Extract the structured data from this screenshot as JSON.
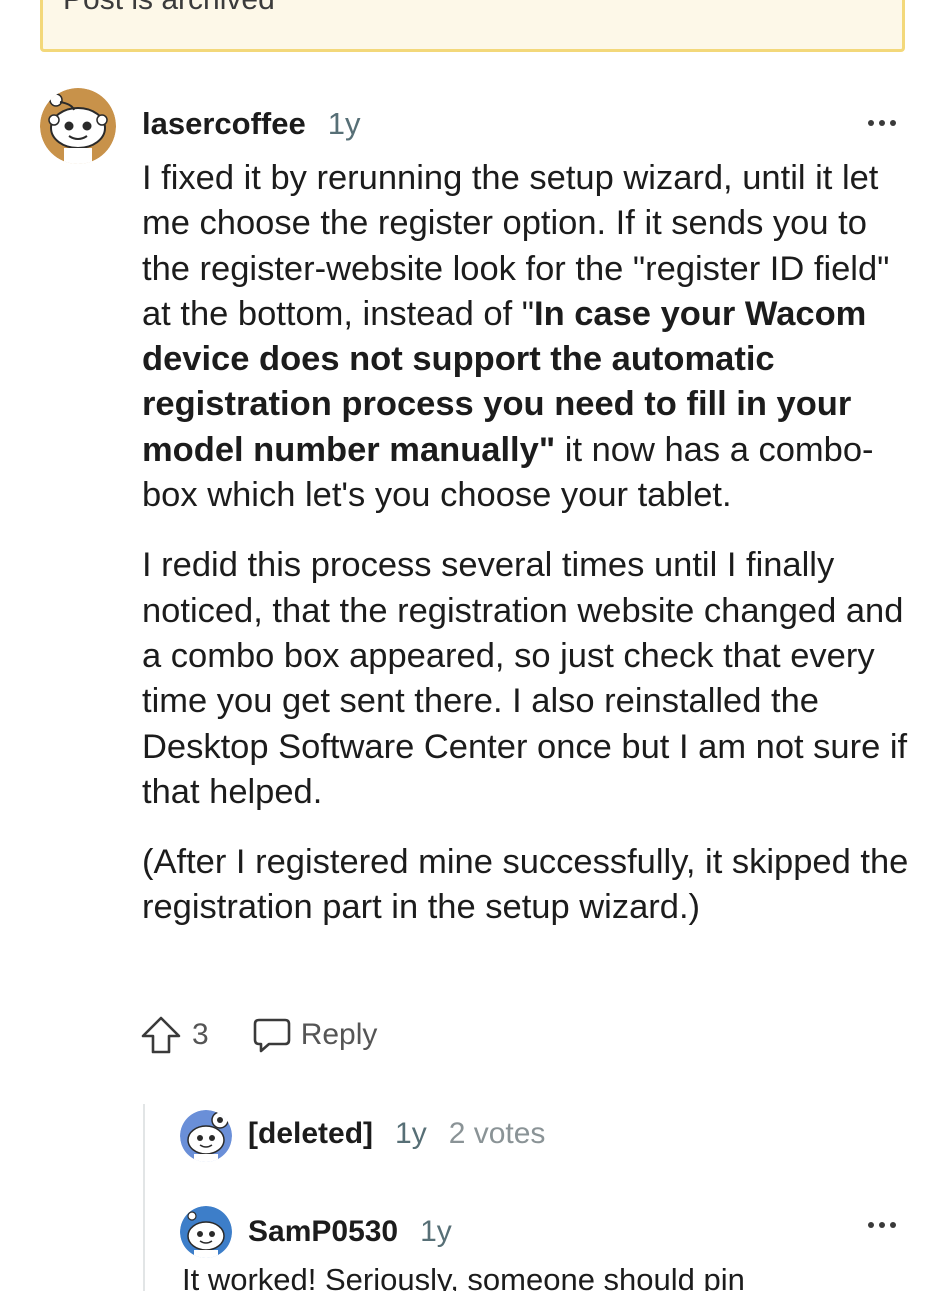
{
  "banner": {
    "text": "Post is archived"
  },
  "comments": [
    {
      "username": "lasercoffee",
      "age": "1y",
      "paragraphs": {
        "p1_a": "I fixed it by rerunning the setup wizard, until it let me choose the register option. If it sends you to the register-website look for the \"register ID field\" at the bottom, instead of \"",
        "p1_bold": "In case your Wacom device does not support the automatic registration process you need to fill in your model number manually\"",
        "p1_b": " it now has a combo-box which let's you choose your tablet.",
        "p2": "I redid this process several times until I finally noticed, that the registration website changed and a combo box appeared, so just check that every time you get sent there. I also reinstalled the Desktop Software Center once but I am not sure if that helped.",
        "p3": "(After I registered mine successfully, it skipped the registration part in the setup wizard.)"
      },
      "votes": "3",
      "reply_label": "Reply",
      "more_icon": "more-horizontal-icon"
    }
  ],
  "replies": [
    {
      "username": "[deleted]",
      "age": "1y",
      "votes": "2 votes"
    },
    {
      "username": "SamP0530",
      "age": "1y",
      "text": "It worked! Seriously, someone should pin",
      "more_icon": "more-horizontal-icon"
    }
  ],
  "colors": {
    "banner_border": "#f3d87a",
    "banner_bg": "#fdf8e8",
    "muted": "#576f76",
    "avatar_tan": "#c8924a",
    "avatar_blue": "#3d7ec9"
  }
}
